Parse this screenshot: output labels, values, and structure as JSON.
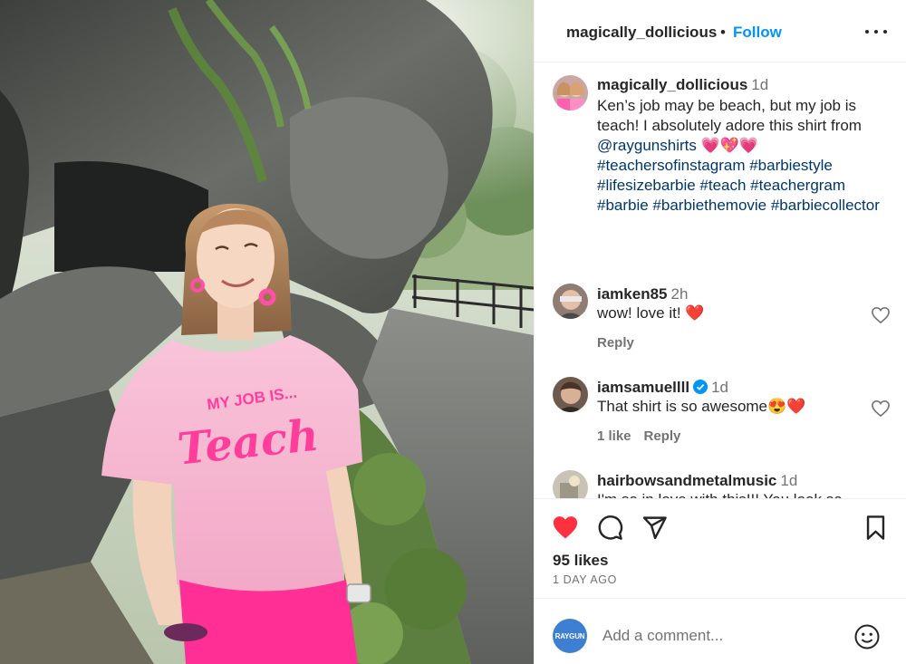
{
  "post": {
    "username": "magically_dollicious",
    "dot": "•",
    "follow_label": "Follow",
    "more_icon": "more-options-icon",
    "photo_shirt_text_top": "MY JOB IS...",
    "photo_shirt_text_main": "Teach"
  },
  "caption": {
    "username": "magically_dollicious",
    "time": "1d",
    "text_1": "Ken’s job may be beach, but my job is teach! I absolutely adore this shirt from ",
    "mention": "@raygunshirts",
    "emojis": " 💗💖💗",
    "hashtags": "#teachersofinstagram #barbiestyle #lifesizebarbie #teach #teachergram #barbie #barbiethemovie #barbiecollector"
  },
  "comments": [
    {
      "username": "iamken85",
      "time": "2h",
      "text": "wow! love it! ❤️",
      "reply_label": "Reply"
    },
    {
      "username": "iamsamuellll",
      "time": "1d",
      "text": "That shirt is so awesome😍❤️",
      "likes_label": "1 like",
      "reply_label": "Reply",
      "verified": true
    },
    {
      "username": "hairbowsandmetalmusic",
      "time": "1d",
      "text": "I'm so in love with this!!! You look so"
    }
  ],
  "actions": {
    "like_icon": "heart-filled-icon",
    "comment_icon": "comment-icon",
    "share_icon": "share-icon",
    "save_icon": "bookmark-icon",
    "likes": "95 likes",
    "time_ago": "1 DAY AGO"
  },
  "add_comment": {
    "avatar_text": "RAYGUN",
    "placeholder": "Add a comment...",
    "emoji_icon": "emoji-icon"
  },
  "colors": {
    "follow": "#0095f6",
    "link": "#00376b",
    "like_red": "#ff3040",
    "shirt_pink": "#f7b8d2",
    "shirt_text": "#ff3d9a",
    "shorts_pink": "#ff2f95"
  }
}
